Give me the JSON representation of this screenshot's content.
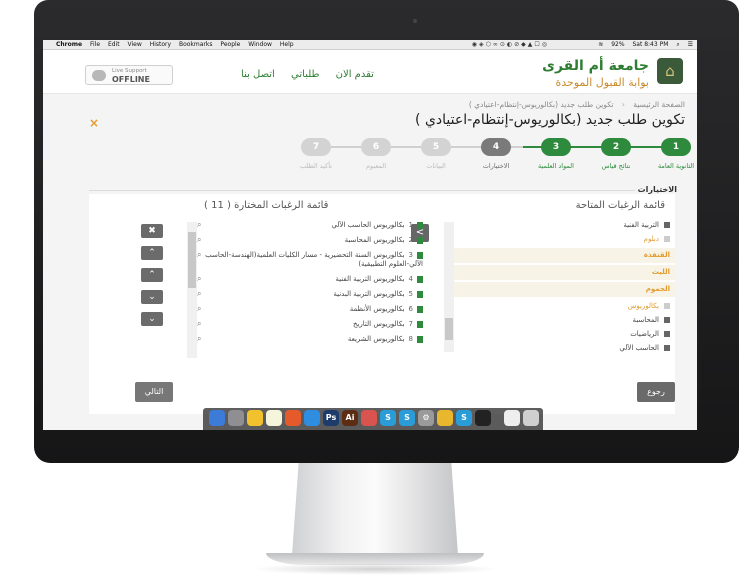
{
  "menubar": {
    "browser": "Chrome",
    "menus": [
      "File",
      "Edit",
      "View",
      "History",
      "Bookmarks",
      "People",
      "Window",
      "Help"
    ],
    "battery": "92%",
    "clock": "Sat 8:43 PM"
  },
  "header": {
    "university": "جامعة أم القرى",
    "portal": "بوابة القبول الموحدة",
    "nav": [
      "تقدم الان",
      "طلباتي",
      "اتصل بنا"
    ],
    "live_support_label": "Live Support",
    "live_support_status": "OFFLINE"
  },
  "breadcrumb": {
    "home": "الصفحة الرئيسية",
    "current": "تكوين طلب جديد (بكالوريوس-إنتظام-اعتيادي )"
  },
  "page_title": "تكوين طلب جديد (بكالوريوس-إنتظام-اعتيادي )",
  "close_symbol": "×",
  "steps": [
    {
      "num": "1",
      "label": "الثانوية العامة",
      "state": "done"
    },
    {
      "num": "2",
      "label": "نتائج قياس",
      "state": "done"
    },
    {
      "num": "3",
      "label": "المواد العلمية",
      "state": "done"
    },
    {
      "num": "4",
      "label": "الاختيارات",
      "state": "current"
    },
    {
      "num": "5",
      "label": "البيانات",
      "state": "todo"
    },
    {
      "num": "6",
      "label": "المعبوم",
      "state": "todo"
    },
    {
      "num": "7",
      "label": "تأكيد الطلب",
      "state": "todo"
    }
  ],
  "panel": {
    "heading": "الاختيارات",
    "available_title": "قائمة الرغبات المتاحة",
    "chosen_title": "قائمة الرغبات المختارة ( 11 )",
    "available": [
      {
        "text": "التربية الفنية",
        "kind": "item"
      },
      {
        "text": "دبلوم",
        "kind": "cat"
      },
      {
        "text": "القنفذة",
        "kind": "sub"
      },
      {
        "text": "الليث",
        "kind": "sub"
      },
      {
        "text": "الجموم",
        "kind": "sub"
      },
      {
        "text": "بكالوريوس",
        "kind": "cat"
      },
      {
        "text": "المحاسبة",
        "kind": "item"
      },
      {
        "text": "الرياضيات",
        "kind": "item"
      },
      {
        "text": "الحاسب الآلي",
        "kind": "item"
      }
    ],
    "chosen": [
      {
        "num": "1",
        "text": "بكالوريوس الحاسب الآلي"
      },
      {
        "num": "2",
        "text": "بكالوريوس المحاسبة"
      },
      {
        "num": "3",
        "text": "بكالوريوس السنة التحضيرية - مسار الكليات العلمية(الهندسة-الحاسب الآلي-العلوم التطبيقية)"
      },
      {
        "num": "4",
        "text": "بكالوريوس التربية الفنية"
      },
      {
        "num": "5",
        "text": "بكالوريوس التربية البدنية"
      },
      {
        "num": "6",
        "text": "بكالوريوس الأنظمة"
      },
      {
        "num": "7",
        "text": "بكالوريوس التاريخ"
      },
      {
        "num": "8",
        "text": "بكالوريوس الشريعة"
      }
    ],
    "next_label": "التالي",
    "back_label": "رجوع",
    "move_symbol": "<"
  },
  "colors": {
    "green": "#2e8b3e",
    "orange": "#e39b2d",
    "gray_step": "#cfcfcf"
  }
}
